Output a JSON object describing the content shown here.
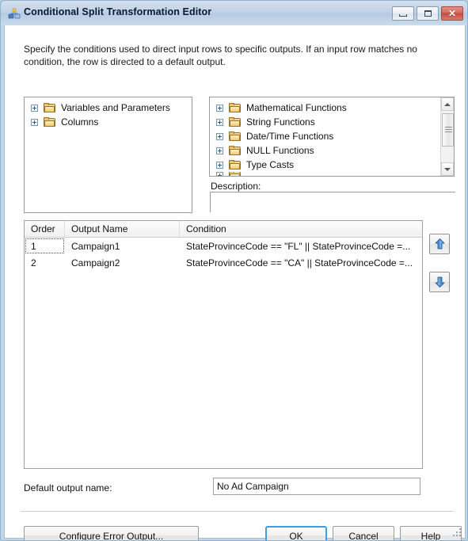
{
  "window": {
    "title": "Conditional Split Transformation Editor",
    "icon": "conditional-split-icon",
    "caption_buttons": {
      "minimize": "Minimize",
      "maximize": "Maximize",
      "close": "Close"
    }
  },
  "intro": "Specify the conditions used to direct input rows to specific outputs. If an input row matches no condition, the row is directed to a default output.",
  "left_tree": {
    "items": [
      {
        "label": "Variables and Parameters",
        "icon": "folder-icon",
        "expander": "plus-icon"
      },
      {
        "label": "Columns",
        "icon": "folder-icon",
        "expander": "plus-icon"
      }
    ]
  },
  "right_tree": {
    "items": [
      {
        "label": "Mathematical Functions",
        "icon": "folder-icon",
        "expander": "plus-icon"
      },
      {
        "label": "String Functions",
        "icon": "folder-icon",
        "expander": "plus-icon"
      },
      {
        "label": "Date/Time Functions",
        "icon": "folder-icon",
        "expander": "plus-icon"
      },
      {
        "label": "NULL Functions",
        "icon": "folder-icon",
        "expander": "plus-icon"
      },
      {
        "label": "Type Casts",
        "icon": "folder-icon",
        "expander": "plus-icon"
      }
    ],
    "scrollbar": {
      "up_icon": "scroll-up-arrow-icon",
      "down_icon": "scroll-down-arrow-icon"
    }
  },
  "description": {
    "label": "Description:",
    "value": "",
    "placeholder": ""
  },
  "grid": {
    "columns": [
      "Order",
      "Output Name",
      "Condition"
    ],
    "rows": [
      {
        "order": "1",
        "output_name": "Campaign1",
        "condition": "StateProvinceCode == \"FL\" || StateProvinceCode =..."
      },
      {
        "order": "2",
        "output_name": "Campaign2",
        "condition": "StateProvinceCode == \"CA\" || StateProvinceCode =..."
      }
    ]
  },
  "move_buttons": {
    "up": "move-up-arrow-icon",
    "down": "move-down-arrow-icon"
  },
  "default_output": {
    "label": "Default output name:",
    "value": "No Ad Campaign"
  },
  "footer": {
    "configure_error_output": "Configure Error Output...",
    "ok": "OK",
    "cancel": "Cancel",
    "help": "Help"
  },
  "colors": {
    "title_bar": "#c1d3e7",
    "focus_blue": "#3c9ee5",
    "close_red": "#c14b3f",
    "folder_gold": "#e0ad4d",
    "arrow_blue": "#2f6fbf"
  }
}
